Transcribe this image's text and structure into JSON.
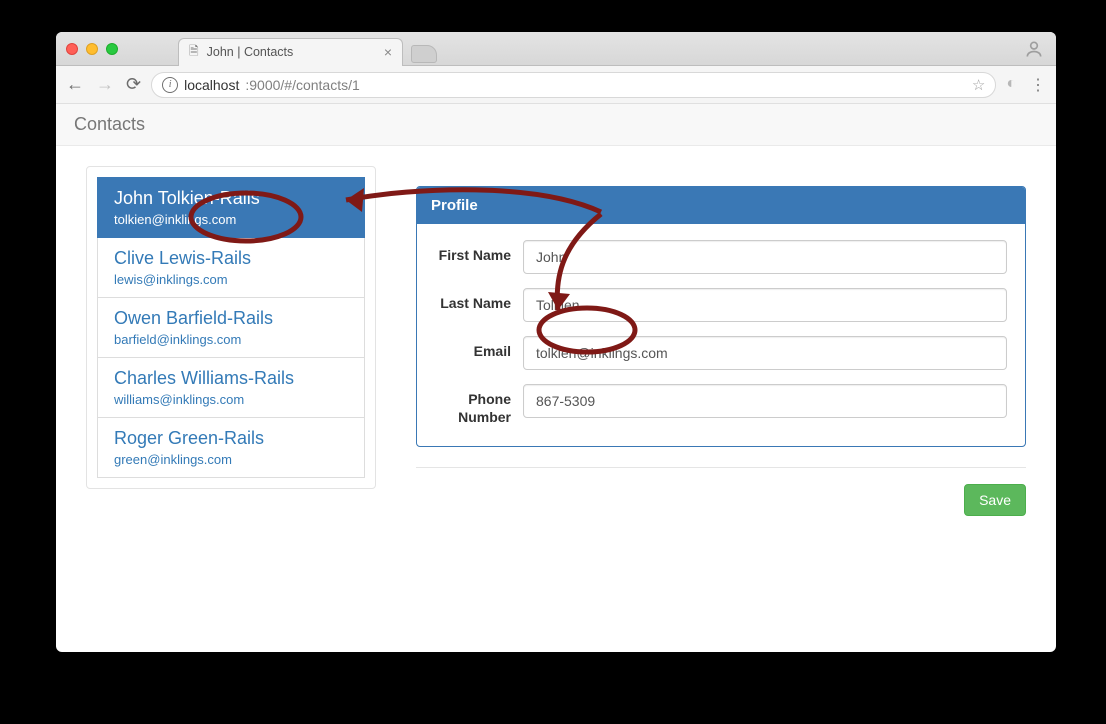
{
  "browser": {
    "tab_title": "John | Contacts",
    "url_host": "localhost",
    "url_port_path": ":9000/#/contacts/1"
  },
  "page": {
    "title": "Contacts"
  },
  "contacts": [
    {
      "name": "John Tolkien-Rails",
      "email": "tolkien@inklings.com",
      "active": true
    },
    {
      "name": "Clive Lewis-Rails",
      "email": "lewis@inklings.com",
      "active": false
    },
    {
      "name": "Owen Barfield-Rails",
      "email": "barfield@inklings.com",
      "active": false
    },
    {
      "name": "Charles Williams-Rails",
      "email": "williams@inklings.com",
      "active": false
    },
    {
      "name": "Roger Green-Rails",
      "email": "green@inklings.com",
      "active": false
    }
  ],
  "profile": {
    "panel_title": "Profile",
    "labels": {
      "first_name": "First Name",
      "last_name": "Last Name",
      "email": "Email",
      "phone": "Phone Number"
    },
    "values": {
      "first_name": "John",
      "last_name": "Tolkien",
      "email": "tolkien@inklings.com",
      "phone": "867-5309"
    },
    "save_label": "Save"
  }
}
